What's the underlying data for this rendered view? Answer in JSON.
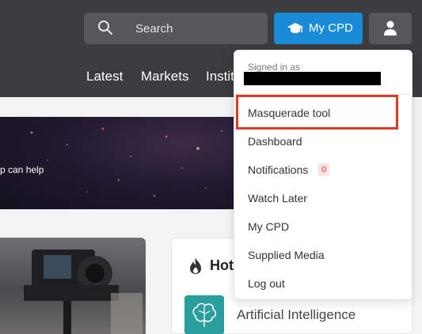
{
  "header": {
    "search": {
      "placeholder": "Search",
      "icon": "search-icon"
    },
    "cpd_button": {
      "label": "My CPD",
      "icon": "graduation-cap-icon",
      "color": "#1a8bd6"
    },
    "user_button": {
      "icon": "user-icon"
    },
    "nav": {
      "items": [
        "Latest",
        "Markets",
        "Instit"
      ]
    }
  },
  "banner": {
    "text": "p can help"
  },
  "hot_section": {
    "title": "Hot",
    "icon": "fire-icon",
    "topic": {
      "label": "Artificial Intelligence",
      "icon": "brain-icon"
    }
  },
  "dropdown": {
    "signed_in_label": "Signed in as",
    "items": [
      "Masquerade tool",
      "Dashboard",
      "Notifications",
      "Watch Later",
      "My CPD",
      "Supplied Media",
      "Log out"
    ],
    "notification_count": "0",
    "highlight_color": "#e03b22"
  }
}
